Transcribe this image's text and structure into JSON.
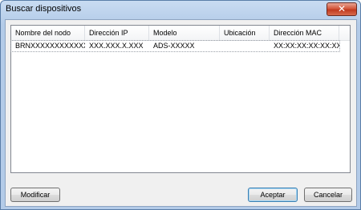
{
  "window": {
    "title": "Buscar dispositivos",
    "close_glyph": "✕"
  },
  "table": {
    "columns": [
      "Nombre del nodo",
      "Dirección IP",
      "Modelo",
      "Ubicación",
      "Dirección MAC"
    ],
    "rows": [
      [
        "BRNXXXXXXXXXXXX",
        "XXX.XXX.X.XXX",
        "ADS-XXXXX",
        "",
        "XX:XX:XX:XX:XX:XX"
      ]
    ]
  },
  "buttons": {
    "modify": "Modificar",
    "accept": "Aceptar",
    "cancel": "Cancelar"
  },
  "colors": {
    "titlebar": "#b3cbe8",
    "close_button": "#c03a1f",
    "default_button_border": "#3c7fb1"
  }
}
